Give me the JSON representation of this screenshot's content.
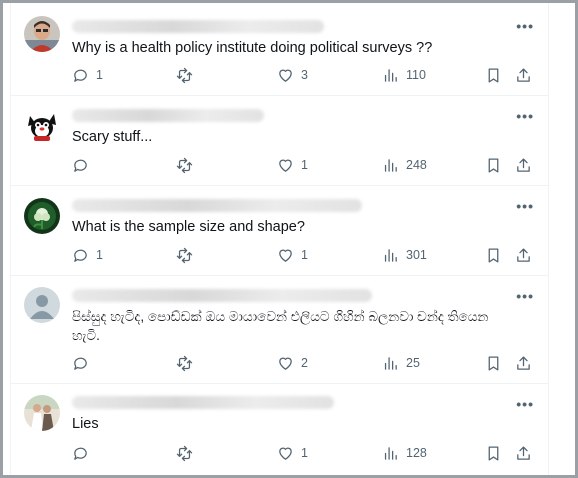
{
  "replies": [
    {
      "text": "Why is a health policy institute doing political surveys ??",
      "replies": "1",
      "reposts": "",
      "likes": "3",
      "views": "110",
      "avatar": "photo-person"
    },
    {
      "text": "Scary stuff...",
      "replies": "",
      "reposts": "",
      "likes": "1",
      "views": "248",
      "avatar": "cartoon-cat"
    },
    {
      "text": "What is the sample size and shape?",
      "replies": "1",
      "reposts": "",
      "likes": "1",
      "views": "301",
      "avatar": "green-flower"
    },
    {
      "text": "පිස්සුද හැටිද, පොඩ්ඩක් ඔය මායාවෙන් එලියට ගිහින් බලනවා චන්ද තියෙන හැටි.",
      "replies": "",
      "reposts": "",
      "likes": "2",
      "views": "25",
      "avatar": "default-user"
    },
    {
      "text": "Lies",
      "replies": "",
      "reposts": "",
      "likes": "1",
      "views": "128",
      "avatar": "photo-couple"
    }
  ],
  "more_label": "•••",
  "colors": {
    "text": "#0f1419",
    "muted": "#536471",
    "border": "#eff3f4"
  }
}
